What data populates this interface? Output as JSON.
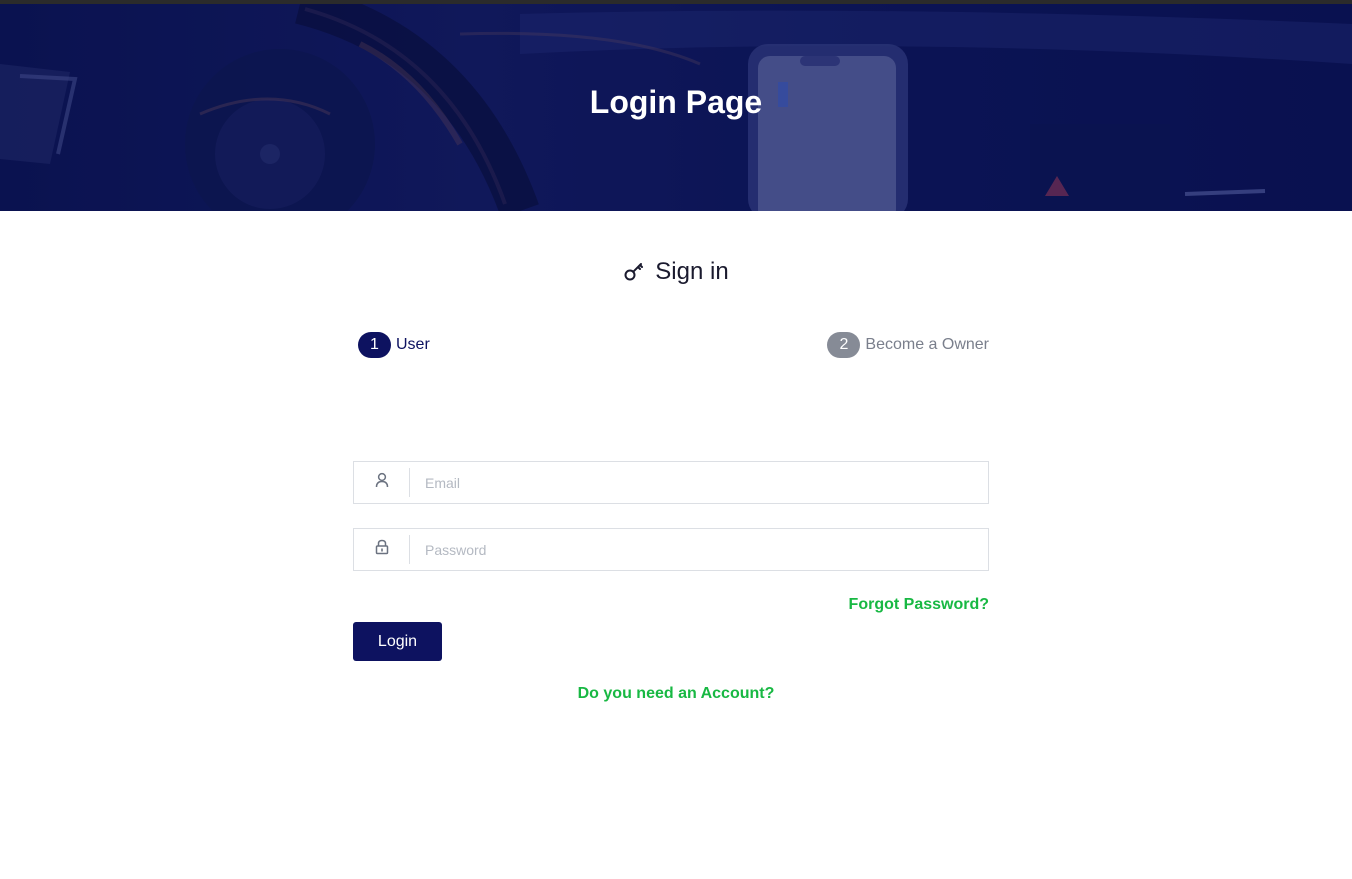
{
  "hero": {
    "title": "Login Page"
  },
  "signin": {
    "heading": "Sign in",
    "icon": "key-icon"
  },
  "steps": [
    {
      "number": "1",
      "label": "User",
      "active": true
    },
    {
      "number": "2",
      "label": "Become a Owner",
      "active": false
    }
  ],
  "form": {
    "email": {
      "placeholder": "Email",
      "value": "",
      "icon": "user-icon"
    },
    "password": {
      "placeholder": "Password",
      "value": "",
      "icon": "lock-icon"
    },
    "forgot_label": "Forgot Password?",
    "login_label": "Login",
    "need_account_label": "Do you need an Account?"
  },
  "colors": {
    "primary": "#0d1260",
    "accent_green": "#18b843",
    "inactive_step": "#868b96"
  }
}
